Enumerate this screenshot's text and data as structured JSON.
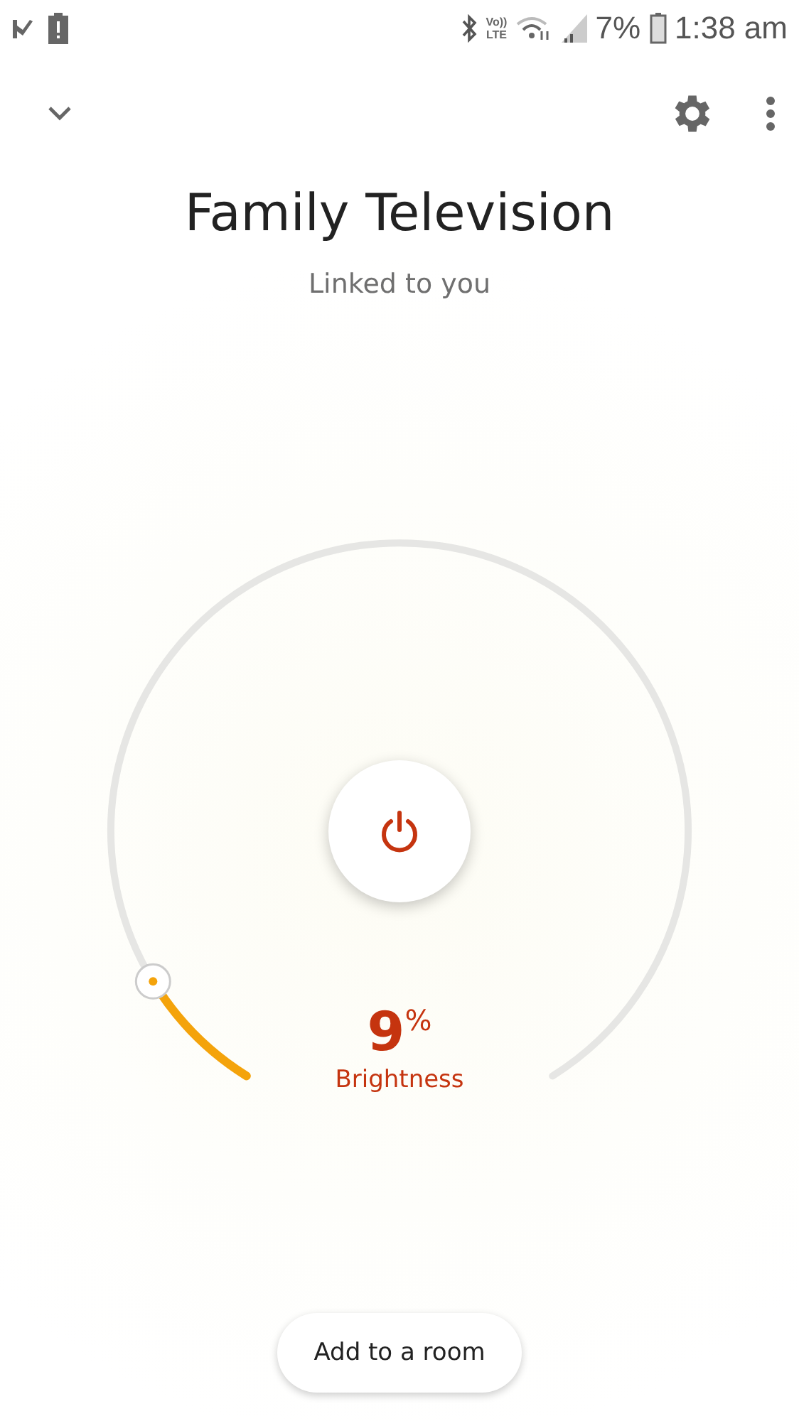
{
  "status_bar": {
    "volte": [
      "Vo))",
      "LTE"
    ],
    "battery": "7%",
    "time": "1:38 am"
  },
  "header": {
    "title": "Family Television",
    "subtitle": "Linked to you"
  },
  "dial": {
    "level": 0.09,
    "value": "9",
    "unit": "%",
    "label": "Brightness",
    "on": true
  },
  "add_button": "Add to a room"
}
